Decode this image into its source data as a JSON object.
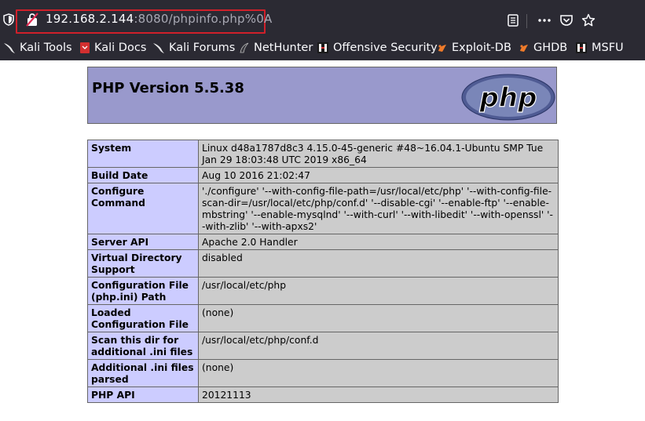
{
  "browser": {
    "url_host": "192.168.2.144",
    "url_rest": ":8080/phpinfo.php%0A",
    "bookmarks": [
      {
        "label": "Kali Tools",
        "icon": "kali-dragon-icon"
      },
      {
        "label": "Kali Docs",
        "icon": "kali-docs-icon"
      },
      {
        "label": "Kali Forums",
        "icon": "kali-dragon-icon"
      },
      {
        "label": "NetHunter",
        "icon": "nethunter-icon"
      },
      {
        "label": "Offensive Security",
        "icon": "offsec-icon"
      },
      {
        "label": "Exploit-DB",
        "icon": "exploitdb-icon"
      },
      {
        "label": "GHDB",
        "icon": "exploitdb-icon"
      },
      {
        "label": "MSFU",
        "icon": "offsec-icon"
      }
    ]
  },
  "php": {
    "version_title": "PHP Version 5.5.38",
    "logo_text": "php",
    "rows": [
      {
        "key": "System",
        "value": "Linux d48a1787d8c3 4.15.0-45-generic #48~16.04.1-Ubuntu SMP Tue Jan 29 18:03:48 UTC 2019 x86_64"
      },
      {
        "key": "Build Date",
        "value": "Aug 10 2016 21:02:47"
      },
      {
        "key": "Configure Command",
        "value": "'./configure' '--with-config-file-path=/usr/local/etc/php' '--with-config-file-scan-dir=/usr/local/etc/php/conf.d' '--disable-cgi' '--enable-ftp' '--enable-mbstring' '--enable-mysqlnd' '--with-curl' '--with-libedit' '--with-openssl' '--with-zlib' '--with-apxs2'"
      },
      {
        "key": "Server API",
        "value": "Apache 2.0 Handler"
      },
      {
        "key": "Virtual Directory Support",
        "value": "disabled"
      },
      {
        "key": "Configuration File (php.ini) Path",
        "value": "/usr/local/etc/php"
      },
      {
        "key": "Loaded Configuration File",
        "value": "(none)"
      },
      {
        "key": "Scan this dir for additional .ini files",
        "value": "/usr/local/etc/php/conf.d"
      },
      {
        "key": "Additional .ini files parsed",
        "value": "(none)"
      },
      {
        "key": "PHP API",
        "value": "20121113"
      }
    ]
  }
}
